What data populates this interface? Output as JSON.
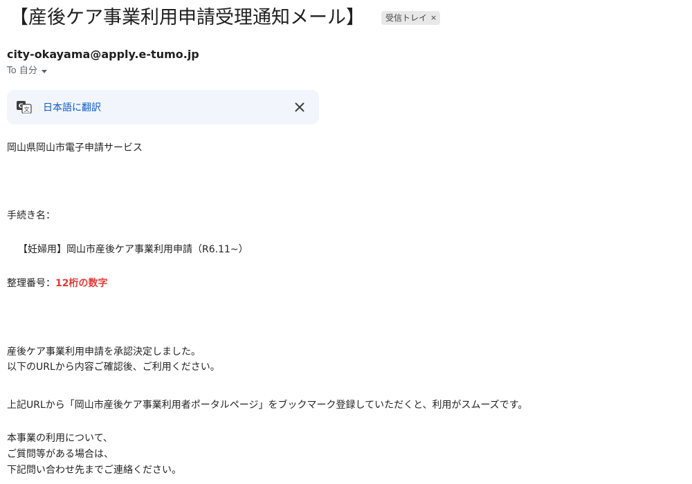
{
  "email": {
    "subject": "【産後ケア事業利用申請受理通知メール】",
    "label_chip": "受信トレイ",
    "label_chip_remove": "×",
    "sender": "city-okayama@apply.e-tumo.jp",
    "recipient": "To 自分"
  },
  "translate_bar": {
    "link": "日本語に翻訳"
  },
  "body": {
    "line1": "岡山県岡山市電子申請サービス",
    "procedure_label": "手続き名：",
    "procedure_name": "【妊婦用】岡山市産後ケア事業利用申請（R6.11~）",
    "ref_label": "整理番号：",
    "ref_value": "12桁の数字",
    "approved_line1": "産後ケア事業利用申請を承認決定しました。",
    "approved_line2": "以下のURLから内容ご確認後、ご利用ください。",
    "bookmark_line": "上記URLから「岡山市産後ケア事業利用者ポータルページ」をブックマーク登録していただくと、利用がスムーズです。",
    "contact_line1": "本事業の利用について、",
    "contact_line2": "ご質問等がある場合は、",
    "contact_line3": "下記問い合わせ先までご連絡ください。"
  },
  "colors": {
    "accent_link": "#0b57d0",
    "highlight_red": "#e53935",
    "translate_bg": "#f2f6fc"
  },
  "icons": {
    "translate": "google-translate-icon",
    "close": "close-icon",
    "caret": "caret-down-icon"
  }
}
